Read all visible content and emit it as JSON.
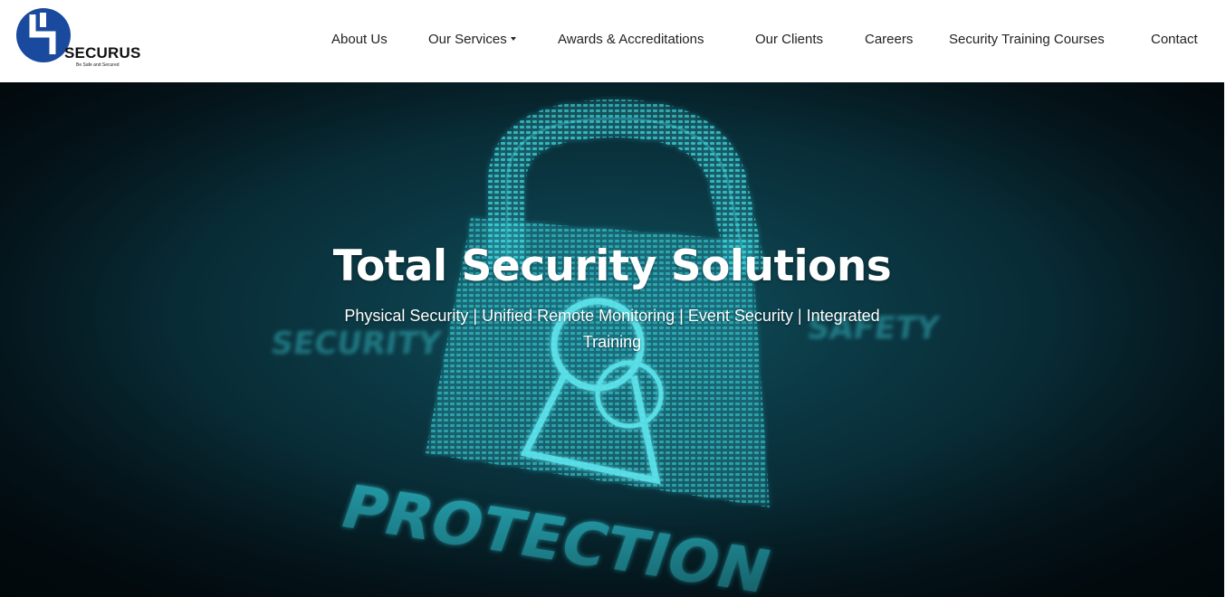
{
  "brand": {
    "name": "SECURUS",
    "tagline": "Be Safe and Secured",
    "logo_color": "#1a4a9e"
  },
  "nav": {
    "items": [
      {
        "label": "About Us"
      },
      {
        "label": "Our Services",
        "has_dropdown": true
      },
      {
        "label": "Awards & Accreditations"
      },
      {
        "label": "Our Clients"
      },
      {
        "label": "Careers"
      },
      {
        "label": "Security Training Courses"
      },
      {
        "label": "Contact"
      }
    ]
  },
  "hero": {
    "title": "Total Security Solutions",
    "subtitle": "Physical Security | Unified Remote Monitoring | Event Security | Integrated Training",
    "background_words": [
      "SECURITY",
      "SAFETY",
      "PROTECTION"
    ],
    "accent_color": "#3fd6e0"
  }
}
